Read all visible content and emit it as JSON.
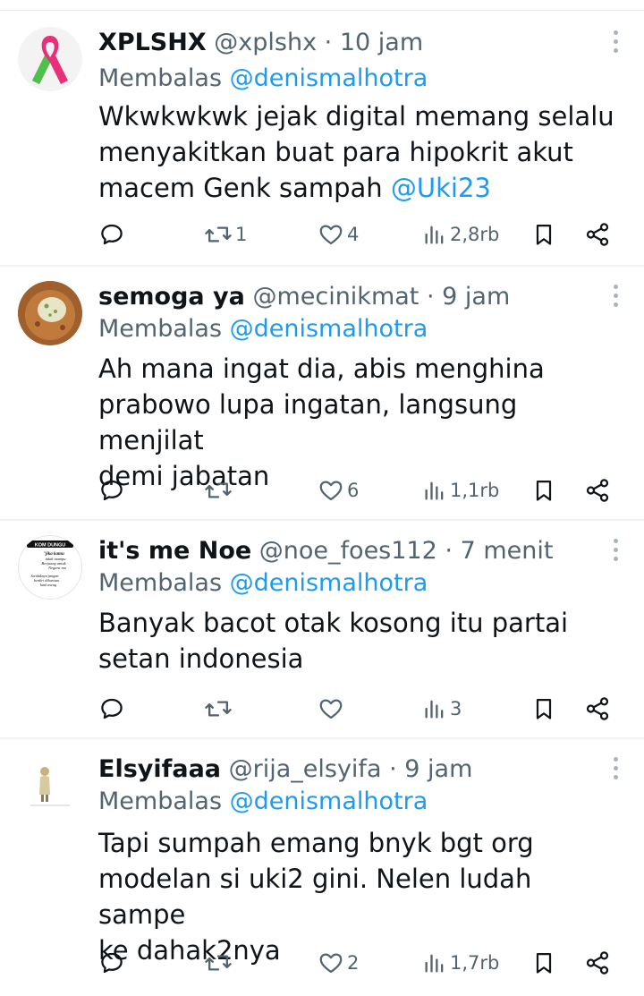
{
  "replying_prefix": "Membalas",
  "tweets": [
    {
      "name": "XPLSHX",
      "handle": "@xplshx",
      "time": "10 jam",
      "reply_to": "@denismalhotra",
      "text_plain": "Wkwkwkwk jejak digital memang selalu\nmenyakitkan buat para hipokrit akut\nmacem Genk sampah ",
      "text_mention": "@Uki23",
      "avatar": "pink-green-ribbon",
      "replies": "",
      "retweets": "1",
      "likes": "4",
      "views": "2,8rb"
    },
    {
      "name": "semoga ya",
      "handle": "@mecinikmat",
      "time": "9 jam",
      "reply_to": "@denismalhotra",
      "text_plain": "Ah mana ingat dia, abis menghina\nprabowo lupa ingatan, langsung menjilat\ndemi jabatan",
      "text_mention": "",
      "avatar": "food-plate",
      "replies": "",
      "retweets": "",
      "likes": "6",
      "views": "1,1rb"
    },
    {
      "name": "it's me Noe",
      "handle": "@noe_foes112",
      "time": "7 menit",
      "reply_to": "@denismalhotra",
      "text_plain": "Banyak bacot otak kosong itu partai\nsetan indonesia",
      "text_mention": "",
      "avatar": "text-quote-badge",
      "avatar_texts": [
        "KOM DUNGU",
        "\"jika kamu",
        "tidak mampu",
        "Berjuang untuk",
        "Negara mu",
        "Setidaknya jangan",
        "berdiri dibarisan",
        "kaul aseng"
      ],
      "replies": "",
      "retweets": "",
      "likes": "",
      "views": "3"
    },
    {
      "name": "Elsyifaaa",
      "handle": "@rija_elsyifa",
      "time": "9 jam",
      "reply_to": "@denismalhotra",
      "text_plain": "Tapi sumpah emang bnyk bgt org\nmodelan si uki2 gini. Nelen ludah sampe\nke dahak2nya",
      "text_mention": "",
      "avatar": "girl-figure",
      "replies": "",
      "retweets": "",
      "likes": "2",
      "views": "1,7rb"
    }
  ],
  "colors": {
    "text": "#0f1419",
    "secondary": "#536471",
    "mention": "#1d9bf0",
    "divider": "#eff3f4"
  }
}
